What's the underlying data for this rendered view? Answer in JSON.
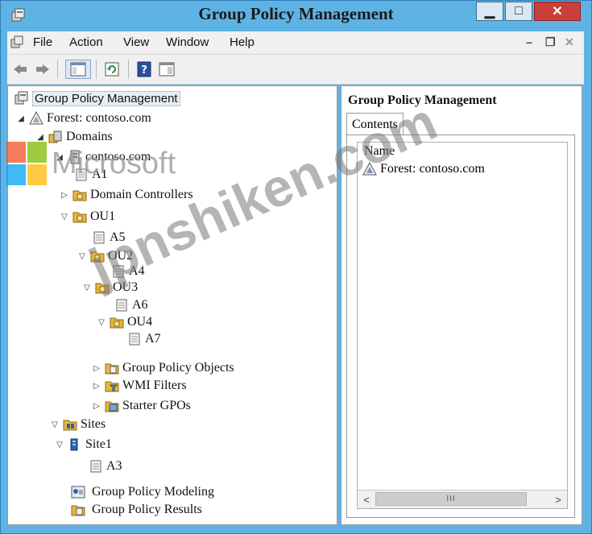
{
  "window": {
    "title": "Group Policy Management"
  },
  "window_buttons": {
    "minimize": "▁",
    "maximize": "□",
    "close": "✕"
  },
  "menu": {
    "items": [
      "File",
      "Action",
      "View",
      "Window",
      "Help"
    ]
  },
  "mdi_controls": {
    "minimize": "–",
    "restore": "❐",
    "close": "✕"
  },
  "tree": [
    {
      "label": "Group Policy Management",
      "icon": "console-icon",
      "twisty": "",
      "selected": true
    },
    {
      "label": "Forest: contoso.com",
      "icon": "forest-icon",
      "twisty": "◢"
    },
    {
      "label": "Domains",
      "icon": "domains-icon",
      "twisty": "◢"
    },
    {
      "label": "contoso.com",
      "icon": "domain-icon",
      "twisty": "◢"
    },
    {
      "label": "A1",
      "icon": "gpo-link-icon",
      "twisty": ""
    },
    {
      "label": "Domain Controllers",
      "icon": "ou-folder-icon",
      "twisty": "▷"
    },
    {
      "label": "OU1",
      "icon": "ou-folder-icon",
      "twisty": "▽"
    },
    {
      "label": "A5",
      "icon": "gpo-link-icon",
      "twisty": ""
    },
    {
      "label": "OU2",
      "icon": "ou-folder-icon",
      "twisty": "▽"
    },
    {
      "label": "A4",
      "icon": "gpo-link-icon",
      "twisty": ""
    },
    {
      "label": "OU3",
      "icon": "ou-folder-icon",
      "twisty": "▽"
    },
    {
      "label": "A6",
      "icon": "gpo-link-icon",
      "twisty": ""
    },
    {
      "label": "OU4",
      "icon": "ou-folder-icon",
      "twisty": "▽"
    },
    {
      "label": "A7",
      "icon": "gpo-link-icon",
      "twisty": ""
    },
    {
      "label": "Group Policy Objects",
      "icon": "gpo-folder-icon",
      "twisty": "▷"
    },
    {
      "label": "WMI Filters",
      "icon": "wmi-folder-icon",
      "twisty": "▷"
    },
    {
      "label": "Starter GPOs",
      "icon": "starter-gpo-icon",
      "twisty": "▷"
    },
    {
      "label": "Sites",
      "icon": "sites-icon",
      "twisty": "▽"
    },
    {
      "label": "Site1",
      "icon": "site-icon",
      "twisty": "▽"
    },
    {
      "label": "A3",
      "icon": "gpo-link-icon",
      "twisty": ""
    },
    {
      "label": "Group Policy Modeling",
      "icon": "modeling-icon",
      "twisty": ""
    },
    {
      "label": "Group Policy Results",
      "icon": "results-icon",
      "twisty": ""
    }
  ],
  "right_pane": {
    "title": "Group Policy Management",
    "tab": "Contents",
    "column_header": "Name",
    "rows": [
      {
        "label": "Forest: contoso.com",
        "icon": "forest-icon"
      }
    ]
  },
  "scrollbar": {
    "left": "<",
    "right": ">",
    "grip": "III"
  },
  "watermarks": {
    "microsoft": "Microsoft",
    "site": "jpnshiken.com"
  },
  "colors": {
    "frame": "#5fb3e4",
    "close_button": "#c9403a",
    "folder": "#e8b63b"
  }
}
